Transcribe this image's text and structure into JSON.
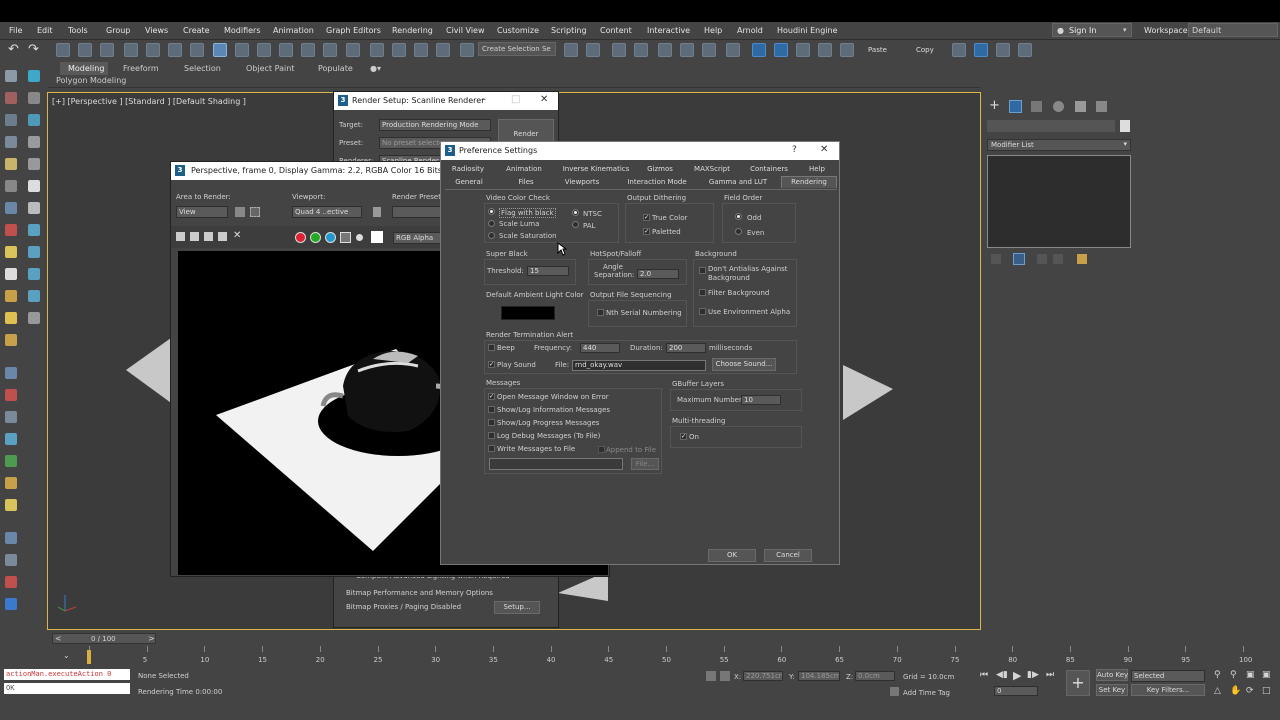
{
  "menubar": {
    "items": [
      "File",
      "Edit",
      "Tools",
      "Group",
      "Views",
      "Create",
      "Modifiers",
      "Animation",
      "Graph Editors",
      "Rendering",
      "Civil View",
      "Customize",
      "Scripting",
      "Content",
      "Interactive",
      "Help",
      "Arnold",
      "Houdini Engine"
    ],
    "sign_in": "Sign In",
    "workspaces_label": "Workspaces:",
    "workspaces_value": "Default"
  },
  "toolbar": {
    "selection_set": "Create Selection Se",
    "paste": "Paste",
    "copy": "Copy"
  },
  "ribbon": {
    "tabs": [
      "Modeling",
      "Freeform",
      "Selection",
      "Object Paint",
      "Populate"
    ],
    "sub": "Polygon Modeling"
  },
  "viewport": {
    "label": "[+] [Perspective ] [Standard ] [Default Shading ]"
  },
  "command_panel": {
    "modifier_list": "Modifier List"
  },
  "render_setup": {
    "title": "Render Setup: Scanline Renderer",
    "target_label": "Target:",
    "target_value": "Production Rendering Mode",
    "preset_label": "Preset:",
    "preset_value": "No preset selecte",
    "renderer_label": "Renderer:",
    "renderer_value": "Scanline Render",
    "render_btn": "Render",
    "compute_text": "Compute Advanced Lighting when Required",
    "bitmap_perf": "Bitmap Performance and Memory Options",
    "bitmap_proxies": "Bitmap Proxies / Paging Disabled",
    "setup_btn": "Setup..."
  },
  "frame_window": {
    "title": "Perspective, frame 0, Display Gamma: 2.2, RGBA Color 16 Bits/Channel",
    "area_label": "Area to Render:",
    "area_value": "View",
    "viewport_label": "Viewport:",
    "viewport_value": "Quad 4 ..ective",
    "preset_label": "Render Preset:",
    "channel_value": "RGB Alpha"
  },
  "pref": {
    "title": "Preference Settings",
    "help": "?",
    "tabs_row1": [
      "Radiosity",
      "Animation",
      "Inverse Kinematics",
      "Gizmos",
      "MAXScript",
      "Containers",
      "Help"
    ],
    "tabs_row2": [
      "General",
      "Files",
      "Viewports",
      "Interaction Mode",
      "Gamma and LUT",
      "Rendering"
    ],
    "video_color_check": "Video Color Check",
    "flag_with_black": "Flag with black",
    "scale_luma": "Scale Luma",
    "scale_saturation": "Scale Saturation",
    "ntsc": "NTSC",
    "pal": "PAL",
    "output_dithering": "Output Dithering",
    "true_color": "True Color",
    "paletted": "Paletted",
    "field_order": "Field Order",
    "odd": "Odd",
    "even": "Even",
    "super_black": "Super Black",
    "threshold_label": "Threshold:",
    "threshold_value": "15",
    "hotspot": "HotSpot/Falloff",
    "angle_sep": "Angle Separation:",
    "angle_sep_value": "2.0",
    "background": "Background",
    "dont_antialias": "Don't Antialias Against Background",
    "filter_background": "Filter Background",
    "use_env_alpha": "Use Environment Alpha",
    "default_ambient": "Default Ambient Light Color",
    "ambient_color": "#000000",
    "output_file_seq": "Output File Sequencing",
    "nth_serial": "Nth Serial Numbering",
    "render_term": "Render Termination Alert",
    "beep": "Beep",
    "frequency_label": "Frequency:",
    "frequency_value": "440",
    "duration_label": "Duration:",
    "duration_value": "200",
    "milliseconds": "milliseconds",
    "play_sound": "Play Sound",
    "file_label": "File:",
    "file_value": "rnd_okay.wav",
    "choose_sound": "Choose Sound...",
    "messages": "Messages",
    "open_msg": "Open Message Window on Error",
    "show_info": "Show/Log Information Messages",
    "show_progress": "Show/Log Progress Messages",
    "log_debug": "Log Debug Messages (To File)",
    "write_msgs": "Write Messages to File",
    "append": "Append to File",
    "file_btn": "File...",
    "gbuffer": "GBuffer Layers",
    "max_number_label": "Maximum Number:",
    "max_number_value": "10",
    "multithread": "Multi-threading",
    "on": "On",
    "ok": "OK",
    "cancel": "Cancel"
  },
  "timeline": {
    "frame": "0 / 100",
    "ticks": [
      "0",
      "5",
      "10",
      "15",
      "20",
      "25",
      "30",
      "35",
      "40",
      "45",
      "50",
      "55",
      "60",
      "65",
      "70",
      "75",
      "80",
      "85",
      "90",
      "95",
      "100"
    ]
  },
  "status": {
    "maxscript": "actionMan.executeAction 0",
    "ok_field": "OK",
    "none_selected": "None Selected",
    "render_time": "Rendering Time  0:00:00",
    "x_label": "X:",
    "x_value": "220.751cm",
    "y_label": "Y:",
    "y_value": "104.185cm",
    "z_label": "Z:",
    "z_value": "0.0cm",
    "grid": "Grid = 10.0cm",
    "add_time_tag": "Add Time Tag",
    "auto_key": "Auto Key",
    "set_key": "Set Key",
    "selected": "Selected",
    "key_filters": "Key Filters...",
    "frame_field": "0"
  }
}
